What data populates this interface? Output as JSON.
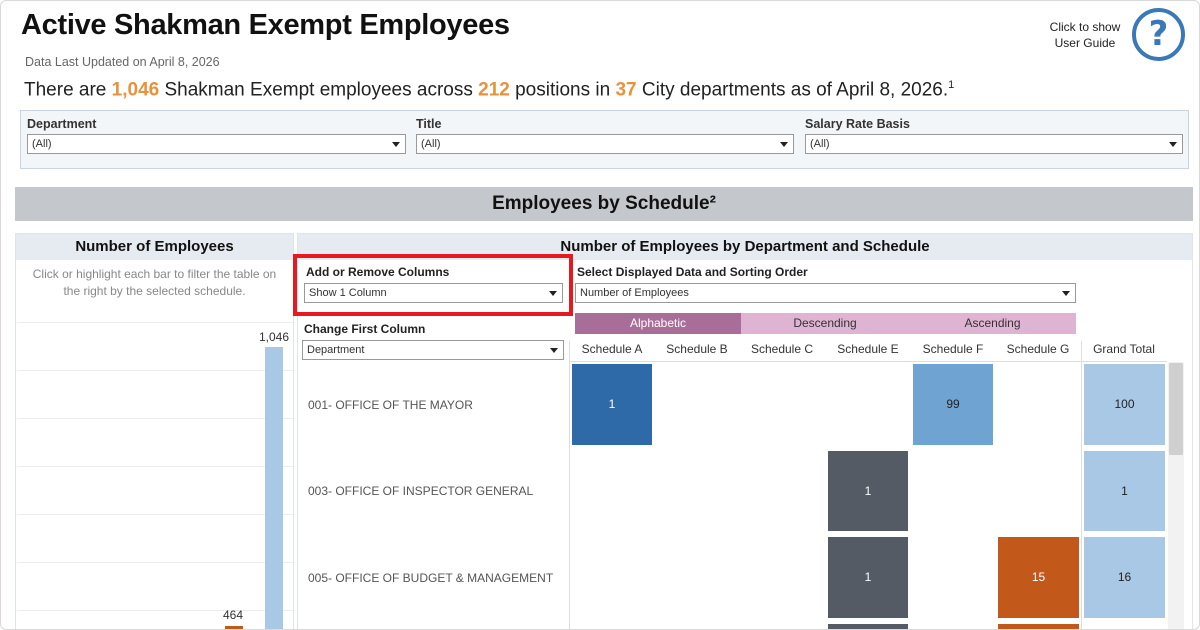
{
  "header": {
    "title": "Active Shakman Exempt Employees",
    "updated": "Data Last Updated on April 8, 2026",
    "summary_parts": {
      "p1": "There are ",
      "employees": "1,046",
      "p2": " Shakman Exempt employees across ",
      "positions": "212",
      "p3": " positions in ",
      "departments": "37",
      "p4": " City departments as of April 8, 2026.",
      "footnote": "1"
    },
    "guide_text": "Click to show User Guide",
    "guide_icon": "question-icon",
    "highlight_color": "#e8923a"
  },
  "filters": [
    {
      "label": "Department",
      "value": "(All)"
    },
    {
      "label": "Title",
      "value": "(All)"
    },
    {
      "label": "Salary Rate Basis",
      "value": "(All)"
    }
  ],
  "section": {
    "title": "Employees by Schedule²"
  },
  "left": {
    "title": "Number of Employees",
    "note": "Click or highlight each bar to filter the table on the right by the selected schedule.",
    "bar_labels": {
      "top": "1,046",
      "mid": "464"
    },
    "colors": {
      "blue": "#a8c8e6",
      "orange": "#c2581a"
    }
  },
  "right": {
    "title": "Number of Employees by Department and Schedule",
    "add_remove_label": "Add or Remove Columns",
    "add_remove_value": "Show 1 Column",
    "display_label": "Select Displayed Data and Sorting Order",
    "display_value": "Number of Employees",
    "first_col_label": "Change First Column",
    "first_col_value": "Department",
    "sort_buttons": [
      "Alphabetic",
      "Descending",
      "Ascending"
    ],
    "columns": [
      "Schedule A",
      "Schedule B",
      "Schedule C",
      "Schedule E",
      "Schedule F",
      "Schedule G",
      "Grand Total"
    ],
    "rows": [
      {
        "dept": "001-  OFFICE OF THE MAYOR",
        "values": [
          "1",
          "",
          "",
          "",
          "99",
          "",
          "100"
        ]
      },
      {
        "dept": "003-  OFFICE OF INSPECTOR GENERAL",
        "values": [
          "",
          "",
          "",
          "1",
          "",
          "",
          "1"
        ]
      },
      {
        "dept": "005-  OFFICE OF BUDGET & MANAGEMENT",
        "values": [
          "",
          "",
          "",
          "1",
          "",
          "15",
          "16"
        ]
      }
    ],
    "colors": {
      "sched_a": "#2e6aa8",
      "sched_e": "#555b64",
      "sched_f": "#6fa3d1",
      "sched_g": "#c2581a",
      "total": "#a8c8e6",
      "sort_active": "#a86d98",
      "sort_inactive": "#dfb4d3"
    }
  }
}
